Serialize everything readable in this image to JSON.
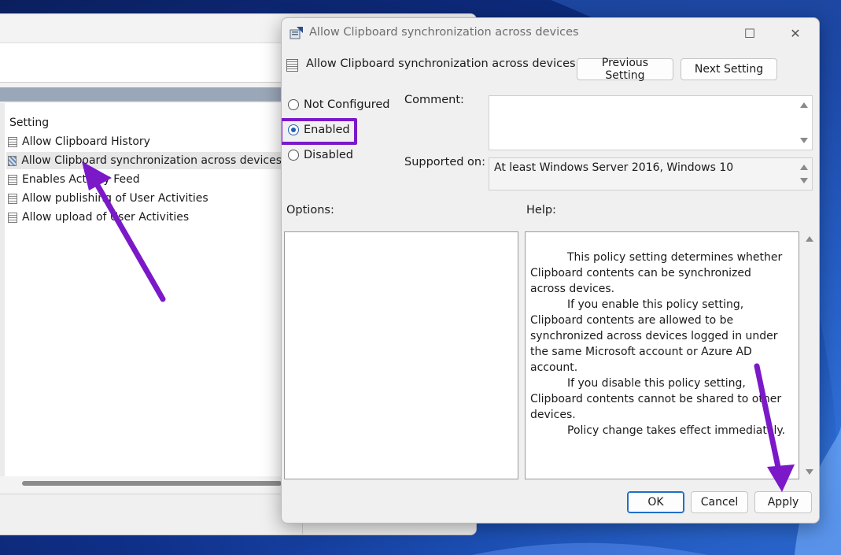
{
  "background_window": {
    "list_header": "Setting",
    "items": [
      {
        "label": "Allow Clipboard History",
        "selected": false
      },
      {
        "label": "Allow Clipboard synchronization across devices",
        "selected": true
      },
      {
        "label": "Enables Activity Feed",
        "selected": false
      },
      {
        "label": "Allow publishing of User Activities",
        "selected": false
      },
      {
        "label": "Allow upload of User Activities",
        "selected": false
      }
    ]
  },
  "dialog": {
    "window_title": "Allow Clipboard synchronization across devices",
    "setting_title": "Allow Clipboard synchronization across devices",
    "previous_setting": "Previous Setting",
    "next_setting": "Next Setting",
    "state_options": [
      {
        "label": "Not Configured",
        "checked": false
      },
      {
        "label": "Enabled",
        "checked": true
      },
      {
        "label": "Disabled",
        "checked": false
      }
    ],
    "comment_label": "Comment:",
    "comment_value": "",
    "supported_on_label": "Supported on:",
    "supported_on_value": "At least Windows Server 2016, Windows 10",
    "options_label": "Options:",
    "help_label": "Help:",
    "help_paragraphs": [
      "This policy setting determines whether Clipboard contents can be synchronized across devices.",
      "If you enable this policy setting, Clipboard contents are allowed to be synchronized across devices logged in under the same Microsoft account or Azure AD account.",
      "If you disable this policy setting, Clipboard contents cannot be shared to other devices.",
      "Policy change takes effect immediately."
    ],
    "ok": "OK",
    "cancel": "Cancel",
    "apply": "Apply",
    "maximize_glyph": "☐",
    "close_glyph": "✕"
  },
  "colors": {
    "annotation": "#7b19c9",
    "radio_selected": "#1f5fb8",
    "primary_button_border": "#1f6fc7"
  }
}
